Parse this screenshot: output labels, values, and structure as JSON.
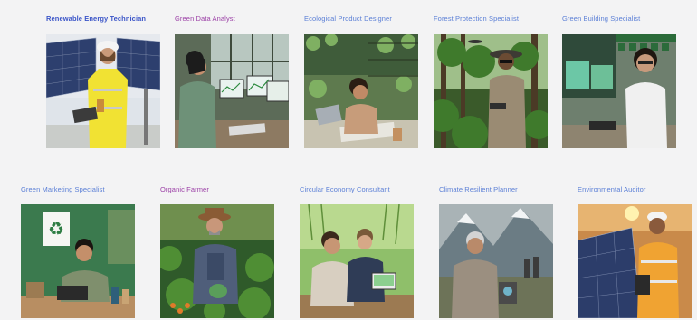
{
  "colors": {
    "background": "#f3f3f4",
    "link_blue": "#5b7fd6",
    "link_purple": "#9b3fa6",
    "link_visited_bold": "#3b55c8"
  },
  "cards": [
    {
      "label": "Renewable Energy Technician",
      "color": "#3b55c8",
      "bold": true,
      "image": "solar-technician-photo"
    },
    {
      "label": "Green Data Analyst",
      "color": "#9b3fa6",
      "bold": false,
      "image": "data-analyst-photo"
    },
    {
      "label": "Ecological Product Designer",
      "color": "#5b7fd6",
      "bold": false,
      "image": "product-designer-photo"
    },
    {
      "label": "Forest Protection Specialist",
      "color": "#5b7fd6",
      "bold": false,
      "image": "forest-specialist-photo"
    },
    {
      "label": "Green Building Specialist",
      "color": "#5b7fd6",
      "bold": false,
      "image": "building-specialist-photo"
    },
    {
      "label": "Green Marketing Specialist",
      "color": "#5b7fd6",
      "bold": false,
      "image": "marketing-specialist-photo"
    },
    {
      "label": "Organic Farmer",
      "color": "#9b3fa6",
      "bold": false,
      "image": "organic-farmer-photo"
    },
    {
      "label": "Circular Economy Consultant",
      "color": "#5b7fd6",
      "bold": false,
      "image": "circular-economy-photo"
    },
    {
      "label": "Climate Resilient Planner",
      "color": "#5b7fd6",
      "bold": false,
      "image": "climate-planner-photo"
    },
    {
      "label": "Environmental Auditor",
      "color": "#5b7fd6",
      "bold": false,
      "image": "environmental-auditor-photo"
    }
  ]
}
